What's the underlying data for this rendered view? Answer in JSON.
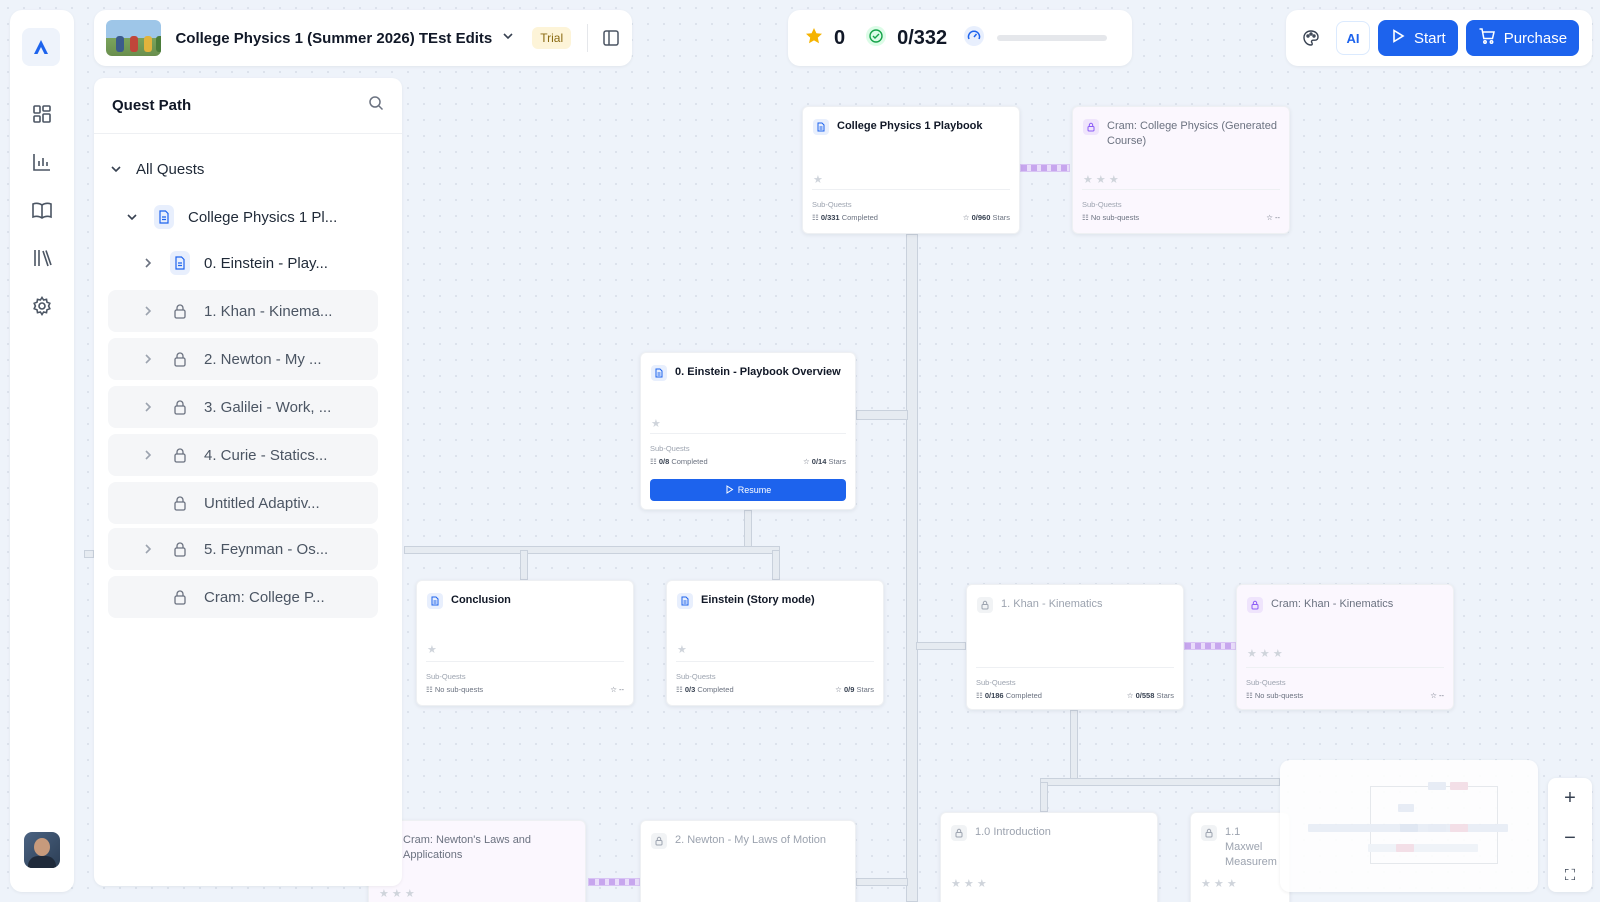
{
  "header": {
    "course_title": "College Physics 1 (Summer 2026) TEst Edits",
    "trial_label": "Trial"
  },
  "stats": {
    "stars": "0",
    "completed": "0/332",
    "progress_fraction": 0
  },
  "actions": {
    "ai_label": "AI",
    "start_label": "Start",
    "purchase_label": "Purchase"
  },
  "quest_panel": {
    "title": "Quest Path",
    "all_quests_label": "All Quests",
    "items": [
      {
        "label": "College Physics 1 Pl...",
        "locked": false
      },
      {
        "label": "0. Einstein - Play...",
        "locked": false
      },
      {
        "label": "1. Khan - Kinema...",
        "locked": true
      },
      {
        "label": "2. Newton - My ...",
        "locked": true
      },
      {
        "label": "3. Galilei - Work, ...",
        "locked": true
      },
      {
        "label": "4. Curie - Statics...",
        "locked": true
      },
      {
        "label": "Untitled Adaptiv...",
        "locked": true
      },
      {
        "label": "5. Feynman - Os...",
        "locked": true
      },
      {
        "label": "Cram: College P...",
        "locked": true
      }
    ]
  },
  "cards": {
    "playbook": {
      "title": "College Physics 1 Playbook",
      "sub_label": "Sub-Quests",
      "completed": "0/331",
      "completed_suffix": "Completed",
      "stars": "0/960",
      "stars_suffix": "Stars"
    },
    "cram_course": {
      "title": "Cram: College Physics (Generated Course)",
      "sub_label": "Sub-Quests",
      "no_sub": "No sub-quests",
      "dash": "--"
    },
    "einstein_overview": {
      "title": "0. Einstein - Playbook Overview",
      "sub_label": "Sub-Quests",
      "completed": "0/8",
      "completed_suffix": "Completed",
      "stars": "0/14",
      "stars_suffix": "Stars",
      "resume_label": "Resume"
    },
    "conclusion": {
      "title": "Conclusion",
      "sub_label": "Sub-Quests",
      "no_sub": "No sub-quests",
      "dash": "--"
    },
    "einstein_story": {
      "title": "Einstein (Story mode)",
      "sub_label": "Sub-Quests",
      "completed": "0/3",
      "completed_suffix": "Completed",
      "stars": "0/9",
      "stars_suffix": "Stars"
    },
    "khan": {
      "title": "1. Khan - Kinematics",
      "sub_label": "Sub-Quests",
      "completed": "0/186",
      "completed_suffix": "Completed",
      "stars": "0/558",
      "stars_suffix": "Stars"
    },
    "cram_khan": {
      "title": "Cram: Khan - Kinematics",
      "sub_label": "Sub-Quests",
      "no_sub": "No sub-quests",
      "dash": "--"
    },
    "cram_newton": {
      "title": "Cram: Newton's Laws and Applications"
    },
    "newton": {
      "title": "2. Newton - My Laws of Motion"
    },
    "intro": {
      "title": "1.0 Introduction"
    },
    "maxwell": {
      "title": "1.1 Maxwel Measurem"
    }
  },
  "zoom": {
    "in": "+",
    "out": "−",
    "fit": "⛶"
  },
  "colors": {
    "primary": "#1d63ed",
    "trial_bg": "#fdf4d8",
    "cram_bg": "#fbf7fe",
    "connector_purple": "#c7a6ee"
  }
}
